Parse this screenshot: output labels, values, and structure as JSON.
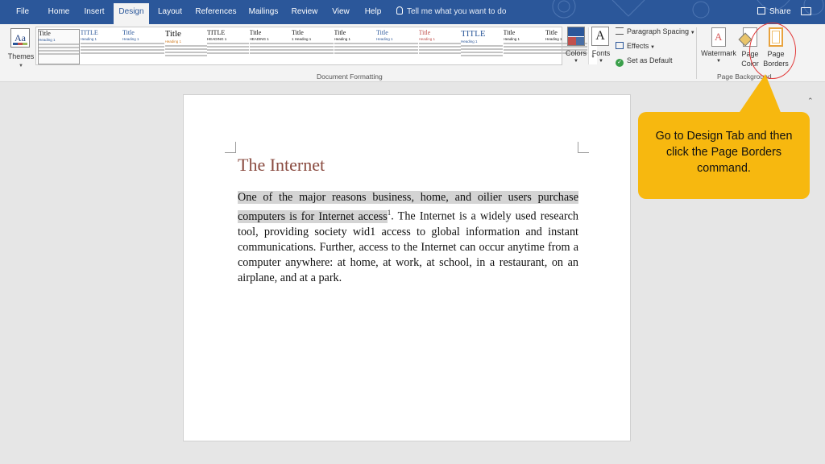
{
  "tabs": [
    {
      "label": "File"
    },
    {
      "label": "Home"
    },
    {
      "label": "Insert"
    },
    {
      "label": "Design"
    },
    {
      "label": "Layout"
    },
    {
      "label": "References"
    },
    {
      "label": "Mailings"
    },
    {
      "label": "Review"
    },
    {
      "label": "View"
    },
    {
      "label": "Help"
    }
  ],
  "active_tab": "Design",
  "tell_me": "Tell me what you want to do",
  "share_label": "Share",
  "ribbon": {
    "themes_label": "Themes",
    "style_gallery": [
      {
        "title": "Title",
        "heading": "Heading 1",
        "title_color": "#111111",
        "heading_color": "#2b579a"
      },
      {
        "title": "TITLE",
        "heading": "Heading 1",
        "title_color": "#2b579a",
        "heading_color": "#2b579a"
      },
      {
        "title": "Title",
        "heading": "Heading 1",
        "title_color": "#2b579a",
        "heading_color": "#2b579a"
      },
      {
        "title": "Title",
        "heading": "Heading 1",
        "title_color": "#111111",
        "heading_color": "#d07a1e"
      },
      {
        "title": "TITLE",
        "heading": "HEADING 1",
        "title_color": "#111111",
        "heading_color": "#111111"
      },
      {
        "title": "Title",
        "heading": "HEADING 1",
        "title_color": "#111111",
        "heading_color": "#111111"
      },
      {
        "title": "Title",
        "heading": "1 Heading 1",
        "title_color": "#111111",
        "heading_color": "#111111"
      },
      {
        "title": "Title",
        "heading": "Heading 1",
        "title_color": "#111111",
        "heading_color": "#111111"
      },
      {
        "title": "Title",
        "heading": "Heading 1",
        "title_color": "#2b579a",
        "heading_color": "#2b579a"
      },
      {
        "title": "Title",
        "heading": "Heading 1",
        "title_color": "#c0504d",
        "heading_color": "#c0504d"
      },
      {
        "title": "TITLE",
        "heading": "Heading 1",
        "title_color": "#2b579a",
        "heading_color": "#2b579a"
      },
      {
        "title": "Title",
        "heading": "Heading 1",
        "title_color": "#111111",
        "heading_color": "#111111"
      },
      {
        "title": "Title",
        "heading": "Heading 1",
        "title_color": "#111111",
        "heading_color": "#111111"
      }
    ],
    "colors_label": "Colors",
    "fonts_label": "Fonts",
    "paragraph_spacing_label": "Paragraph Spacing",
    "effects_label": "Effects",
    "set_default_label": "Set as Default",
    "document_formatting_group": "Document Formatting",
    "watermark_label": "Watermark",
    "page_color_label_1": "Page",
    "page_color_label_2": "Color",
    "page_borders_label_1": "Page",
    "page_borders_label_2": "Borders",
    "page_background_group": "Page Background"
  },
  "document": {
    "title": "The Internet",
    "body_highlighted_1": "One of the major reasons business, home, and oilier users purchase",
    "body_highlighted_2": "computers is for Internet access",
    "footnote": "1",
    "body_rest": ". The Internet is a widely used research tool, providing society wid1 access to global information and instant communications. Further, access to the Internet can occur anytime from a computer anywhere: at home, at work, at school, in a restaurant, on an airplane, and at a park."
  },
  "callout_text": "Go to Design Tab and then click the Page Borders command.",
  "colors": {
    "tab_bar": "#2b579a",
    "callout": "#f7b80f",
    "highlight_circle": "#e23a3a",
    "doc_title": "#8a4b40"
  }
}
